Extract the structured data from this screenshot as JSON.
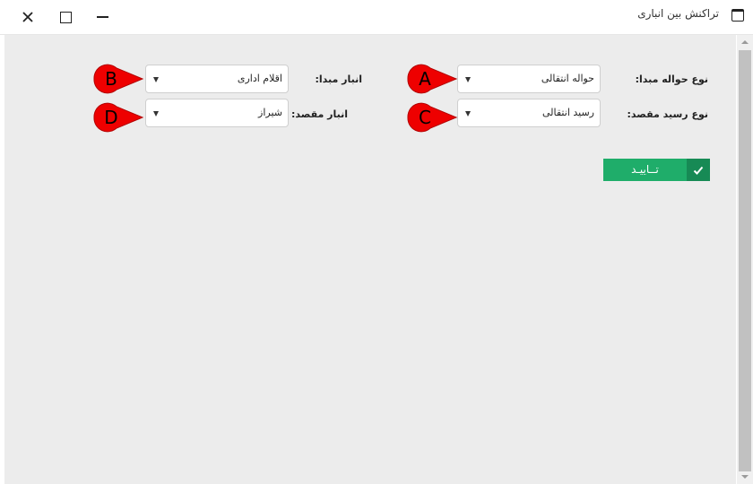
{
  "window": {
    "title": "تراکنش بین انباری"
  },
  "form": {
    "source_doc_type": {
      "label": "نوع حواله مبدا:",
      "value": "حواله انتقالی",
      "marker": "A"
    },
    "source_warehouse": {
      "label": "انبار مبدا:",
      "value": "اقلام اداری",
      "marker": "B"
    },
    "dest_doc_type": {
      "label": "نوع رسید مقصد:",
      "value": "رسید انتقالی",
      "marker": "C"
    },
    "dest_warehouse": {
      "label": "انبار مقصد:",
      "value": "شیراز",
      "marker": "D"
    }
  },
  "actions": {
    "confirm_label": "تــاییـد"
  },
  "colors": {
    "marker_fill": "#ee0000",
    "confirm_bg": "#1fad6a",
    "confirm_check_bg": "#178a55",
    "content_bg": "#ececec"
  },
  "icons": {
    "window": "window-icon",
    "close": "close-icon",
    "maximize": "maximize-icon",
    "minimize": "minimize-icon",
    "check": "check-icon",
    "dropdown": "chevron-down-icon"
  }
}
